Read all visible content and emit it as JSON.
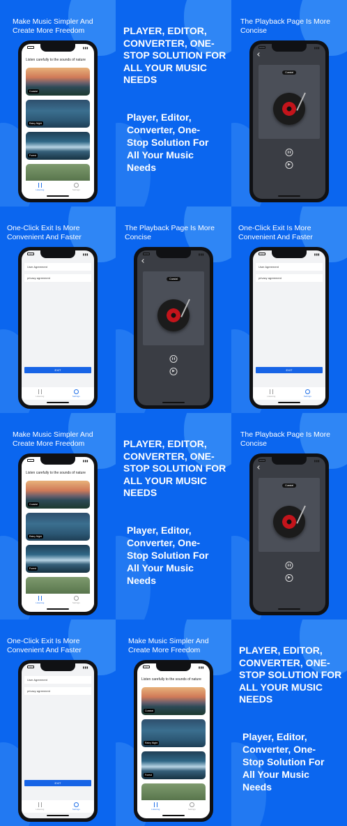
{
  "captions": {
    "make_music": "Make Music Simpler And Create More Freedom",
    "playback": "The Playback Page Is More Concise",
    "one_click": "One-Click Exit Is More Convenient And Faster"
  },
  "promo": {
    "upper": "PLAYER, EDITOR, CONVERTER, ONE-STOP SOLUTION FOR ALL YOUR MUSIC NEEDS",
    "lower": "Player, Editor, Converter, One-Stop Solution For All Your Music Needs"
  },
  "home": {
    "title": "Listen carefully to the sounds of nature",
    "cards": [
      "Coastal",
      "Rainy Night",
      "Forest",
      ""
    ],
    "tabs": [
      "Listening",
      "Settings"
    ]
  },
  "settings": {
    "rows": [
      "User Agreement",
      "privacy agreement"
    ],
    "exit": "EXIT"
  },
  "player": {
    "track": "Coastal",
    "pause_icon": "pause-icon",
    "play_icon": "play-icon"
  },
  "colors": {
    "background": "#0b66ef",
    "exit_button": "#1764e6",
    "record": "#c3141b"
  }
}
